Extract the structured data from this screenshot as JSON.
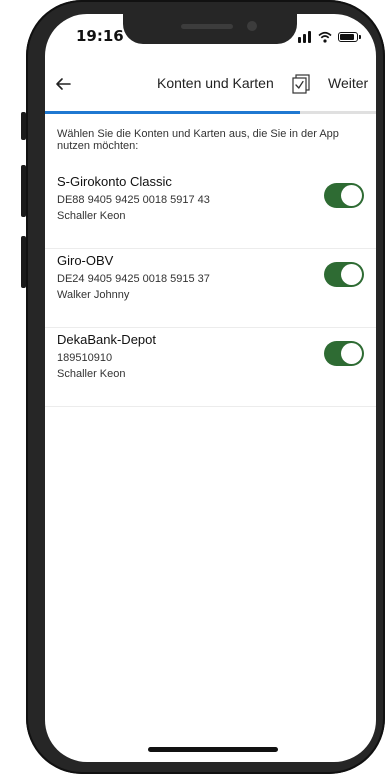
{
  "status_bar": {
    "time": "19:16"
  },
  "nav": {
    "title": "Konten und Karten",
    "next_label": "Weiter",
    "progress": 0.77
  },
  "intro_text": "Wählen Sie die Konten und Karten aus, die Sie in der App nutzen möchten:",
  "accounts": [
    {
      "name": "S-Girokonto Classic",
      "number": "DE88 9405 9425 0018 5917 43",
      "owner": "Schaller Keon",
      "enabled": true
    },
    {
      "name": "Giro-OBV",
      "number": "DE24 9405 9425 0018 5915 37",
      "owner": "Walker Johnny",
      "enabled": true
    },
    {
      "name": "DekaBank-Depot",
      "number": "189510910",
      "owner": "Schaller Keon",
      "enabled": true
    }
  ],
  "colors": {
    "accent": "#1f78d1",
    "toggle_on": "#2e6b33"
  }
}
